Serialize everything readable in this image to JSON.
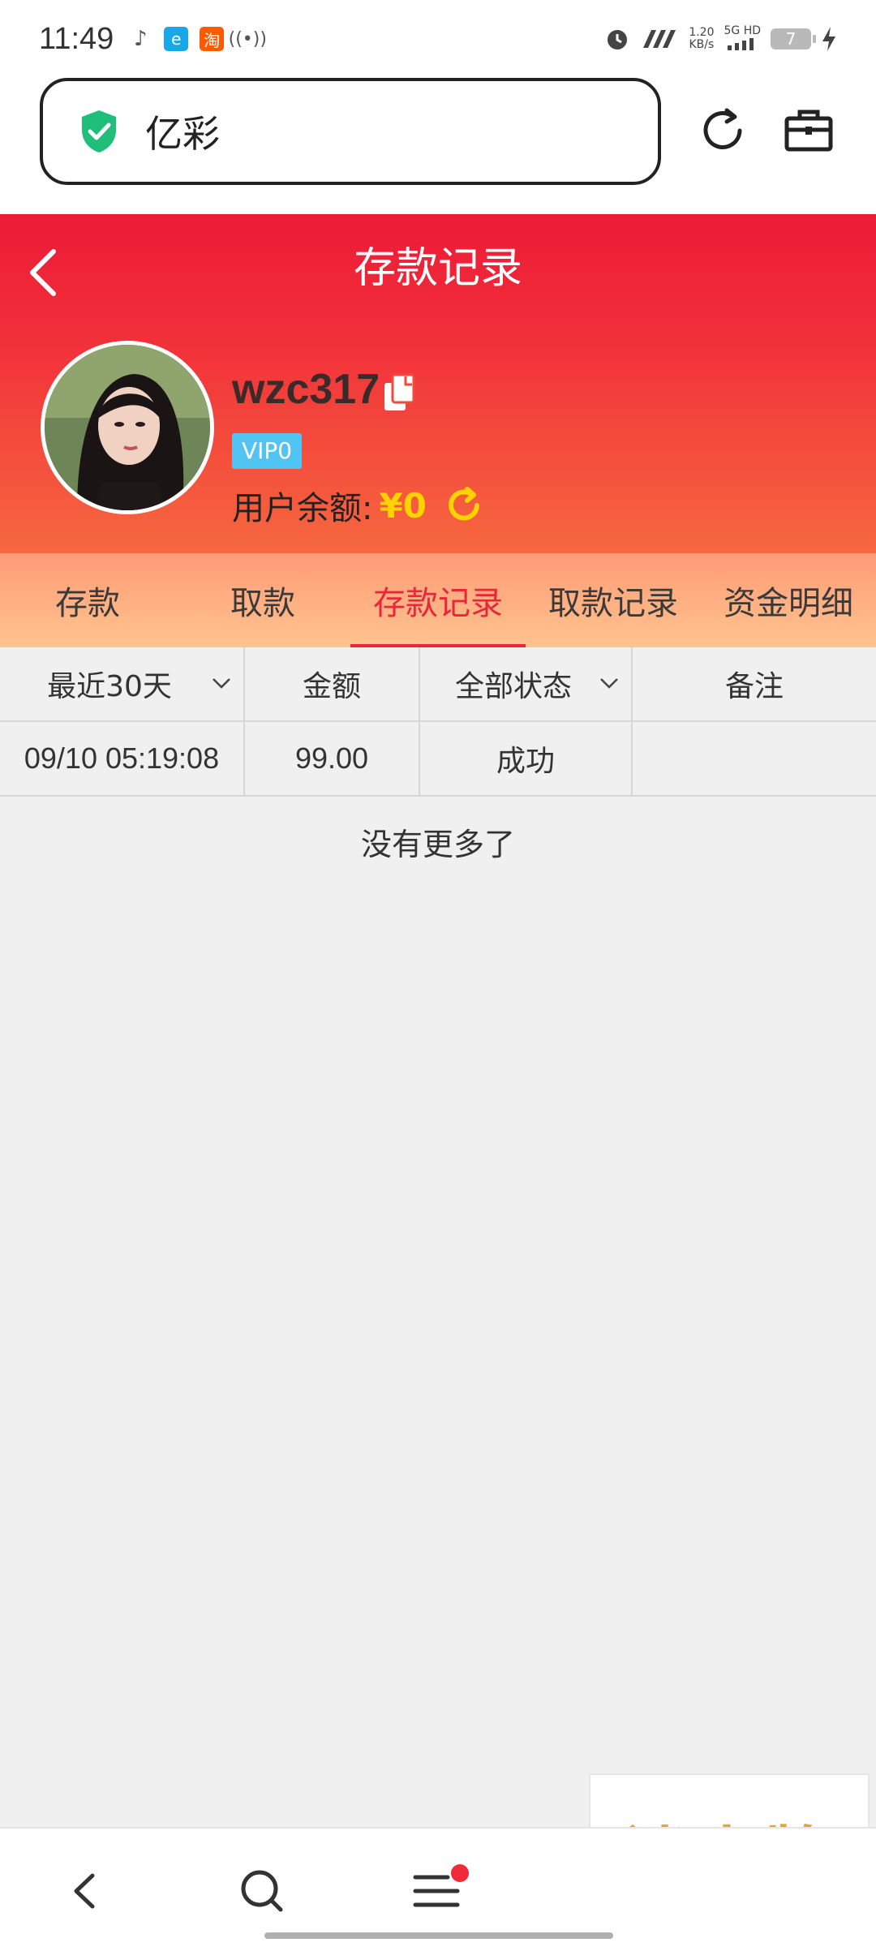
{
  "status_bar": {
    "time": "11:49",
    "speed_value": "1.20",
    "speed_unit": "KB/s",
    "network": "5G HD",
    "battery": "7",
    "taobao_char": "淘"
  },
  "browser": {
    "url_text": "亿彩"
  },
  "header": {
    "title": "存款记录",
    "username": "wzc317",
    "vip": "VIP0",
    "balance_label": "用户余额:",
    "balance_value": "¥0"
  },
  "tabs": [
    {
      "label": "存款"
    },
    {
      "label": "取款"
    },
    {
      "label": "存款记录"
    },
    {
      "label": "取款记录"
    },
    {
      "label": "资金明细"
    }
  ],
  "active_tab_index": 2,
  "table": {
    "headers": [
      "最近30天",
      "金额",
      "全部状态",
      "备注"
    ],
    "rows": [
      {
        "time": "09/10 05:19:08",
        "amount": "99.00",
        "status": "成功",
        "note": ""
      }
    ],
    "footer": "没有更多了"
  },
  "ad": {
    "text": "迷人牌"
  },
  "colors": {
    "primary_red": "#ec1a36",
    "active_tab": "#e8283a",
    "balance_yellow": "#ffd200",
    "vip_blue": "#52c4f4"
  }
}
